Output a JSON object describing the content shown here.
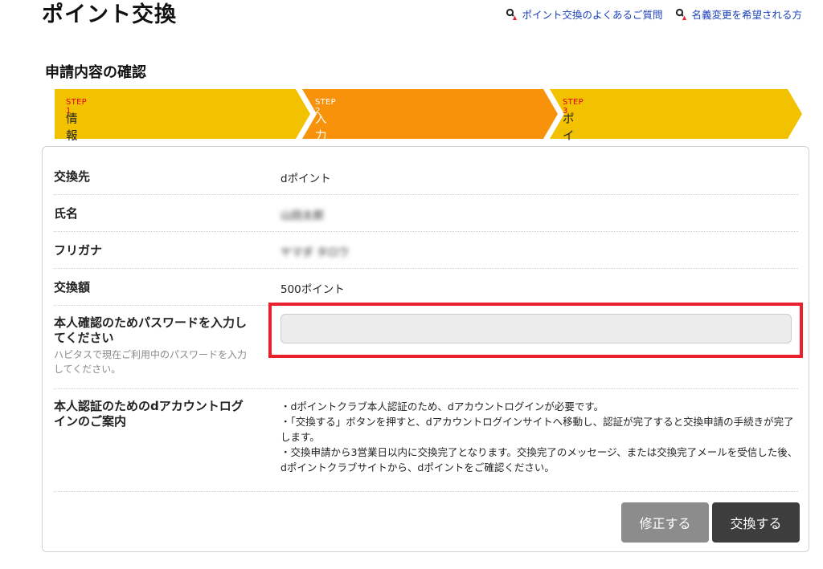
{
  "page": {
    "title": "ポイント交換"
  },
  "top_links": [
    {
      "label": "ポイント交換のよくあるご質問",
      "icon": "search-person-icon"
    },
    {
      "label": "名義変更を希望される方",
      "icon": "search-person-icon"
    }
  ],
  "section": {
    "title": "申請内容の確認"
  },
  "steps": [
    {
      "number": "STEP 1",
      "label": "情報入力",
      "color": "#f2c200"
    },
    {
      "number": "STEP 2",
      "label": "入力情報確認",
      "color": "#f7920a",
      "active": true
    },
    {
      "number": "STEP 3",
      "label": "ポイント交換申請完了",
      "color": "#f2c200"
    }
  ],
  "rows": [
    {
      "label": "交換先",
      "value": "dポイント"
    },
    {
      "label": "氏名",
      "value": "山田太郎"
    },
    {
      "label": "フリガナ",
      "value": "ヤマダ タロウ"
    },
    {
      "label": "交換額",
      "value": "500ポイント"
    }
  ],
  "password": {
    "label": "本人確認のためパスワードを入力してください",
    "help": "ハピタスで現在ご利用中のパスワードを入力してください。",
    "value": "",
    "placeholder": ""
  },
  "guide": {
    "label": "本人認証のためのdアカウントログインのご案内",
    "text": "・dポイントクラブ本人認証のため、dアカウントログインが必要です。\n・「交換する」ボタンを押すと、dアカウントログインサイトへ移動し、認証が完了すると交換申請の手続きが完了します。\n・交換申請から3営業日以内に交換完了となります。交換完了のメッセージ、または交換完了メールを受信した後、dポイントクラブサイトから、dポイントをご確認ください。"
  },
  "buttons": {
    "edit": "修正する",
    "exchange": "交換する"
  },
  "colors": {
    "highlight": "#e8212c",
    "link": "#1a3fb8"
  }
}
